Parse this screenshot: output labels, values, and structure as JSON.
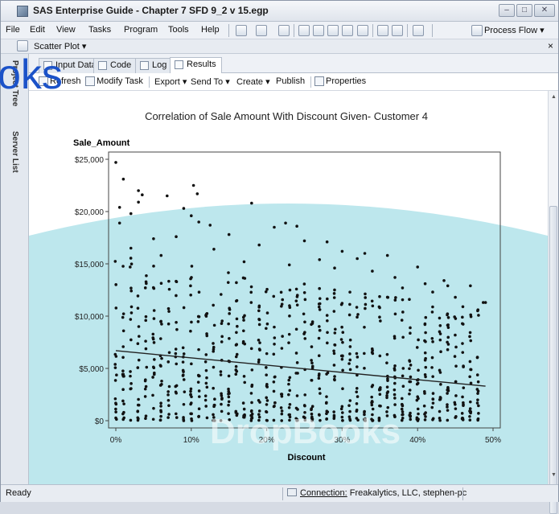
{
  "window": {
    "title": "SAS Enterprise Guide - Chapter 7 SFD 9_2 v 15.egp",
    "controls": [
      "–",
      "□",
      "✕"
    ]
  },
  "menu": {
    "items": [
      "File",
      "Edit",
      "View",
      "Tasks",
      "Program",
      "Tools",
      "Help"
    ],
    "process_flow": "Process Flow ▾"
  },
  "pane": {
    "label": "Scatter Plot ▾",
    "close": "×"
  },
  "sidebar": {
    "tabs": [
      "Project Tree",
      "Server List"
    ]
  },
  "tabs": {
    "items": [
      "Input Data",
      "Code",
      "Log",
      "Results"
    ],
    "active": "Results"
  },
  "actions": {
    "refresh": "Refresh",
    "modify_task": "Modify Task",
    "export": "Export ▾",
    "send_to": "Send To ▾",
    "create": "Create ▾",
    "publish": "Publish",
    "properties": "Properties"
  },
  "overlay_text": "oks",
  "watermark": "DropBooks",
  "status": {
    "ready": "Ready",
    "connection_label": "Connection:",
    "connection_value": "Freakalytics, LLC, stephen-pc"
  },
  "colors": {
    "plot_frame": "#444444",
    "points": "#111111",
    "regression": "#222222",
    "overlay_band": "#7fcfdc",
    "overlay_text": "#1b52c8"
  },
  "chart_data": {
    "type": "scatter",
    "title": "Correlation of Sale Amount With Discount Given- Customer 4",
    "xlabel": "Discount",
    "ylabel": "Sale_Amount",
    "x_ticks": [
      "0%",
      "10%",
      "20%",
      "30%",
      "40%",
      "50%"
    ],
    "y_ticks": [
      "$0",
      "$5,000",
      "$10,000",
      "$15,000",
      "$20,000",
      "$25,000"
    ],
    "xlim": [
      0,
      0.5
    ],
    "ylim": [
      0,
      25000
    ],
    "regression_line": {
      "x": [
        0,
        0.49
      ],
      "y": [
        6700,
        3300
      ]
    },
    "series": [
      {
        "points": [
          [
            0.0,
            24700
          ],
          [
            0.005,
            20400
          ],
          [
            0.005,
            18900
          ],
          [
            0.01,
            23100
          ],
          [
            0.02,
            19800
          ],
          [
            0.03,
            22000
          ],
          [
            0.03,
            20900
          ],
          [
            0.035,
            21600
          ],
          [
            0.05,
            17400
          ],
          [
            0.068,
            21500
          ],
          [
            0.09,
            20300
          ],
          [
            0.1,
            19600
          ],
          [
            0.103,
            22500
          ],
          [
            0.108,
            21700
          ],
          [
            0.11,
            19000
          ],
          [
            0.125,
            18700
          ],
          [
            0.15,
            17800
          ],
          [
            0.18,
            20800
          ],
          [
            0.21,
            18500
          ],
          [
            0.225,
            18900
          ],
          [
            0.24,
            18600
          ],
          [
            0.25,
            17200
          ],
          [
            0.28,
            17100
          ],
          [
            0.3,
            16200
          ],
          [
            0.32,
            15500
          ],
          [
            0.33,
            16000
          ],
          [
            0.36,
            15800
          ],
          [
            0.4,
            14700
          ],
          [
            0.41,
            13100
          ],
          [
            0.42,
            12300
          ],
          [
            0.435,
            13400
          ],
          [
            0.44,
            12900
          ],
          [
            0.47,
            12900
          ],
          [
            0.487,
            11300
          ],
          [
            0.49,
            11300
          ],
          [
            0.02,
            16500
          ],
          [
            0.06,
            15800
          ],
          [
            0.08,
            17600
          ],
          [
            0.13,
            16400
          ],
          [
            0.17,
            15200
          ],
          [
            0.19,
            16800
          ],
          [
            0.23,
            14900
          ],
          [
            0.27,
            15400
          ],
          [
            0.29,
            14600
          ],
          [
            0.34,
            14300
          ],
          [
            0.37,
            13700
          ],
          [
            0.38,
            12700
          ],
          [
            0.45,
            11800
          ],
          [
            0.46,
            10900
          ],
          [
            0.48,
            10600
          ]
        ]
      }
    ]
  }
}
